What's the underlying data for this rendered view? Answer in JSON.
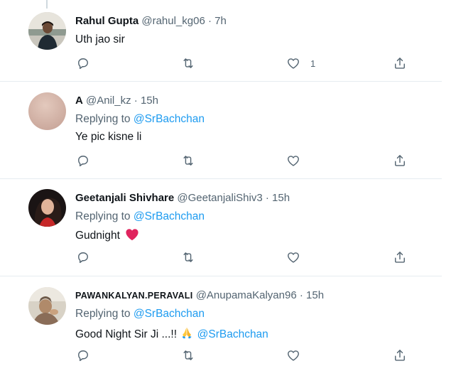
{
  "tweets": [
    {
      "name": "Rahul Gupta",
      "handle": "@rahul_kg06",
      "time": "· 7h",
      "reply_prefix": "",
      "reply_target": "",
      "text": "Uth jao sir",
      "like_count": "1",
      "avatar": "photo-person-outdoors"
    },
    {
      "name": "A",
      "handle": "@Anil_kz",
      "time": "· 15h",
      "reply_prefix": "Replying to",
      "reply_target": "@SrBachchan",
      "text": "Ye pic kisne li",
      "like_count": "",
      "avatar": "plain-beige-circle"
    },
    {
      "name": "Geetanjali Shivhare",
      "handle": "@GeetanjaliShiv3",
      "time": "· 15h",
      "reply_prefix": "Replying to",
      "reply_target": "@SrBachchan",
      "text": "Gudnight",
      "text_emoji": "red-heart-emoji",
      "like_count": "",
      "avatar": "photo-woman-portrait"
    },
    {
      "name": "PAWANKALYAN.PERAVALI",
      "handle": "@AnupamaKalyan96",
      "time": "· 15h",
      "reply_prefix": "Replying to",
      "reply_target": "@SrBachchan",
      "text": "Good Night Sir Ji ...!!",
      "text_emoji": "folded-hands-emoji",
      "text_mention": "@SrBachchan",
      "like_count": "",
      "avatar": "photo-person-sepia"
    }
  ],
  "icons": {
    "reply": "reply-icon",
    "retweet": "retweet-icon",
    "like": "heart-icon",
    "share": "share-icon"
  },
  "colors": {
    "link": "#1d9bf0",
    "icon": "#536471",
    "text": "#0f1419",
    "divider": "#e6ecf0",
    "heart": "#e0245e"
  }
}
